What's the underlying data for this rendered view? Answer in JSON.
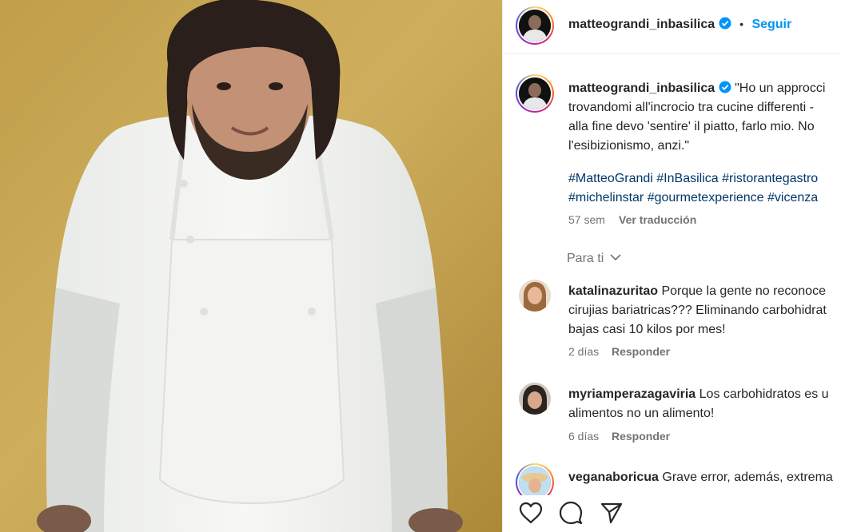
{
  "post": {
    "author": "matteograndi_inbasilica",
    "follow_label": "Seguir",
    "dot": "•",
    "caption_line1": "\"Ho un approcci",
    "caption_line2": "trovandomi all'incrocio tra cucine differenti -",
    "caption_line3": "alla fine devo 'sentire' il piatto, farlo mio. No",
    "caption_line4": "l'esibizionismo, anzi.\"",
    "hashtags_line1": "#MatteoGrandi #InBasilica #ristorantegastro",
    "hashtags_line2": "#michelinstar #gourmetexperience #vicenza",
    "age": "57 sem",
    "translate_label": "Ver traducción"
  },
  "filter": {
    "label": "Para ti"
  },
  "comments": [
    {
      "user": "katalinazuritao",
      "text1": "Porque la gente no reconoce",
      "text2": "cirujias bariatricas??? Eliminando carbohidrat",
      "text3": "bajas casi 10 kilos por mes!",
      "age": "2 días",
      "reply": "Responder"
    },
    {
      "user": "myriamperazagaviria",
      "text1": "Los carbohidratos es u",
      "text2": "alimentos no un alimento!",
      "age": "6 días",
      "reply": "Responder"
    },
    {
      "user": "veganaboricua",
      "text1": "Grave error, además, extrema"
    }
  ],
  "icons": {
    "like": "heart-icon",
    "comment": "comment-icon",
    "share": "send-icon",
    "verified": "verified-badge-icon",
    "chevron": "chevron-down-icon"
  },
  "colors": {
    "link": "#0095f6",
    "hashtag": "#00376b",
    "muted": "#737373",
    "verified": "#0095f6"
  }
}
